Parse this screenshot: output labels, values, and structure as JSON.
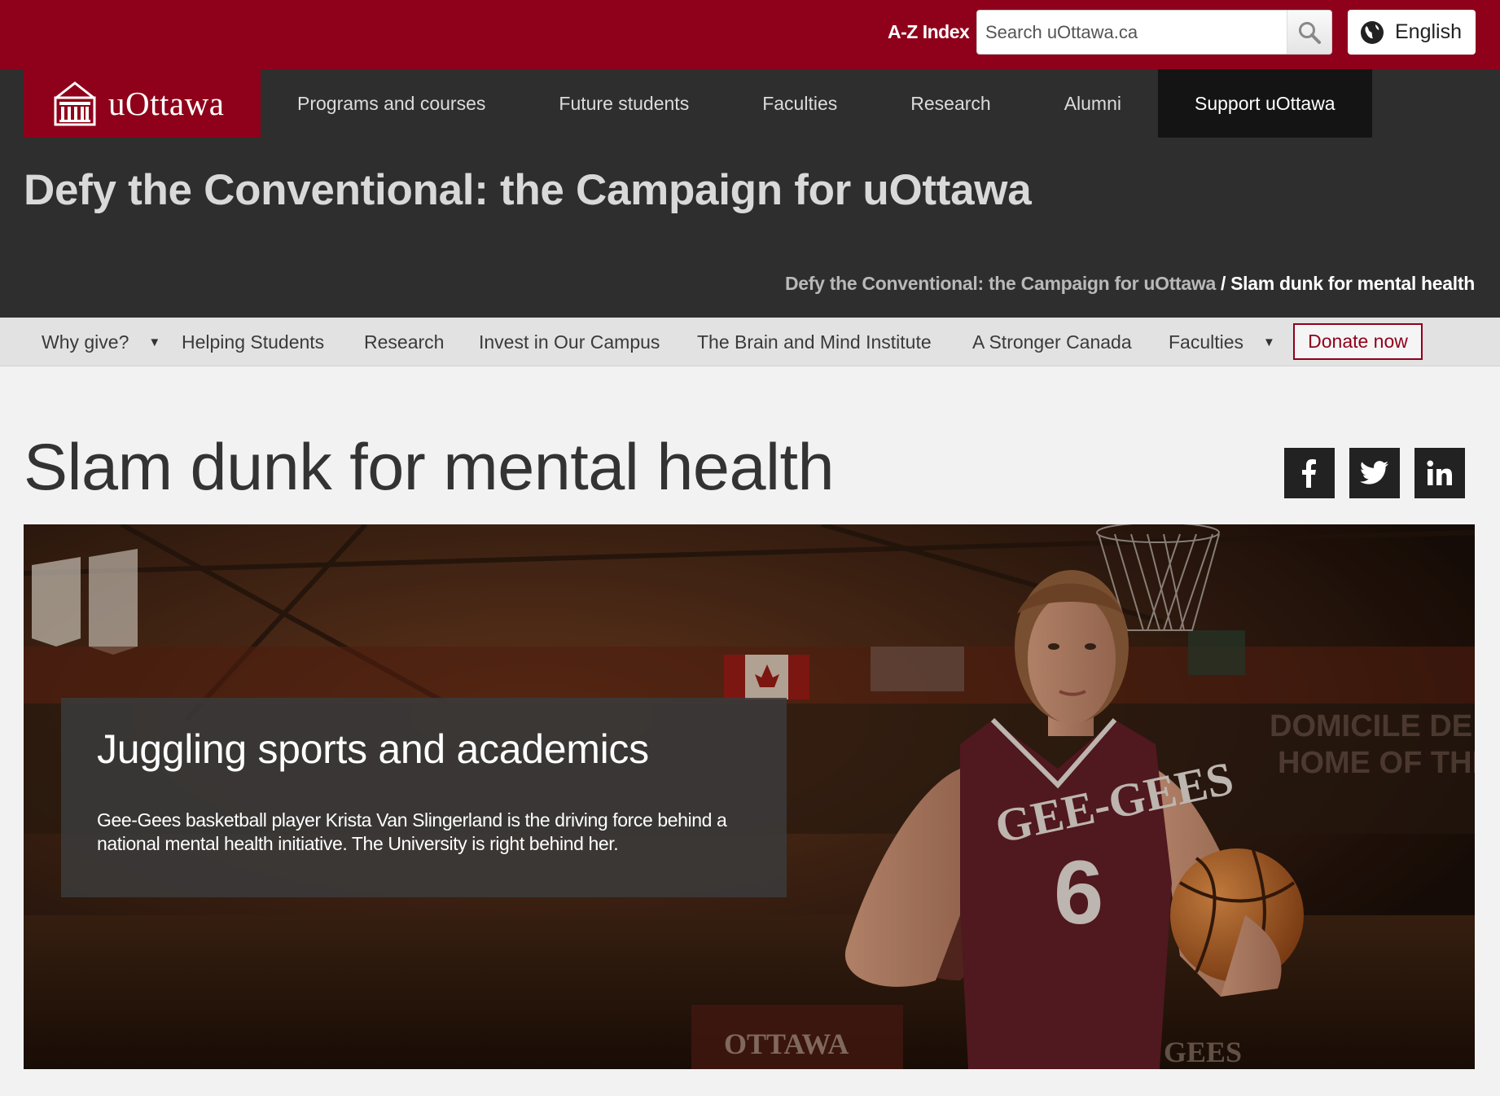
{
  "topbar": {
    "az_index": "A-Z Index",
    "search_placeholder": "Search uOttawa.ca",
    "language": "English"
  },
  "logo": {
    "text": "uOttawa"
  },
  "main_nav": {
    "items": [
      "Programs and courses",
      "Future students",
      "Faculties",
      "Research",
      "Alumni",
      "Support uOttawa"
    ]
  },
  "campaign_title": "Defy the Conventional: the Campaign for uOttawa",
  "breadcrumb": {
    "parent": "Defy the Conventional: the Campaign for uOttawa",
    "separator": "/",
    "current": "Slam dunk for mental health"
  },
  "sub_nav": {
    "items": [
      "Why give?",
      "Helping Students",
      "Research",
      "Invest in Our Campus",
      "The Brain and Mind Institute",
      "A Stronger Canada",
      "Faculties"
    ],
    "donate": "Donate now"
  },
  "page_title": "Slam dunk for mental health",
  "social": [
    "facebook",
    "twitter",
    "linkedin"
  ],
  "hero": {
    "heading": "Juggling sports and academics",
    "text": "Gee-Gees basketball player Krista Van Slingerland is the driving force behind a national mental health initiative. The University is right behind her."
  },
  "colors": {
    "brand": "#8f001a",
    "header_dark": "#2e2e2f"
  }
}
